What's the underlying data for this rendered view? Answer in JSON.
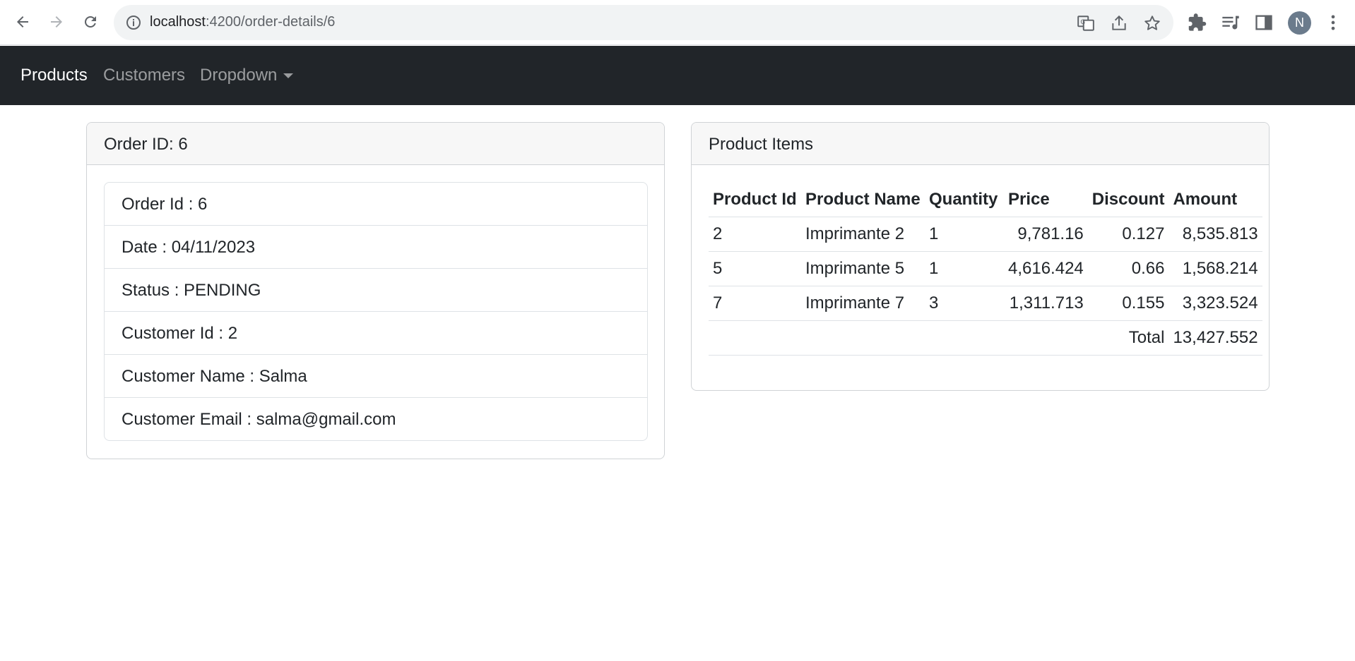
{
  "browser": {
    "url_host": "localhost",
    "url_path": ":4200/order-details/6",
    "profile_initial": "N"
  },
  "navbar": {
    "items": [
      {
        "label": "Products"
      },
      {
        "label": "Customers"
      },
      {
        "label": "Dropdown"
      }
    ]
  },
  "order_card": {
    "header": "Order ID: 6",
    "fields": [
      "Order Id : 6",
      "Date : 04/11/2023",
      "Status : PENDING",
      "Customer Id : 2",
      "Customer Name : Salma",
      "Customer Email : salma@gmail.com"
    ]
  },
  "items_card": {
    "header": "Product Items",
    "columns": [
      "Product Id",
      "Product Name",
      "Quantity",
      "Price",
      "Discount",
      "Amount"
    ],
    "rows": [
      [
        "2",
        "Imprimante 2",
        "1",
        "9,781.16",
        "0.127",
        "8,535.813"
      ],
      [
        "5",
        "Imprimante 5",
        "1",
        "4,616.424",
        "0.66",
        "1,568.214"
      ],
      [
        "7",
        "Imprimante 7",
        "3",
        "1,311.713",
        "0.155",
        "3,323.524"
      ]
    ],
    "total_label": "Total",
    "total_value": "13,427.552"
  }
}
